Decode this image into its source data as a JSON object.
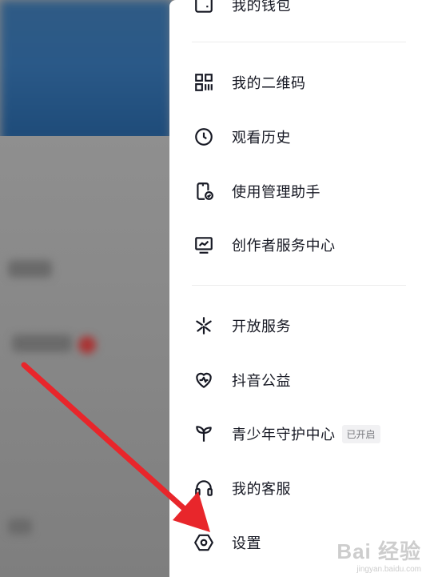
{
  "menu": {
    "wallet": "我的钱包",
    "qrcode": "我的二维码",
    "history": "观看历史",
    "usage_manager": "使用管理助手",
    "creator_center": "创作者服务中心",
    "open_services": "开放服务",
    "charity": "抖音公益",
    "youth_mode": "青少年守护中心",
    "youth_badge": "已开启",
    "customer_service": "我的客服",
    "settings": "设置"
  },
  "watermark": {
    "brand": "Bai 经验",
    "site": "jingyan.baidu.com"
  },
  "colors": {
    "arrow": "#e8262b",
    "text": "#161823",
    "drawer_bg": "#ffffff"
  },
  "icons": {
    "wallet": "wallet-icon",
    "qrcode": "qrcode-icon",
    "history": "clock-icon",
    "usage_manager": "phone-check-icon",
    "creator_center": "monitor-chart-icon",
    "open_services": "sparkle-icon",
    "charity": "heart-icon",
    "youth_mode": "sprout-icon",
    "customer_service": "headset-icon",
    "settings": "hexagon-gear-icon"
  }
}
